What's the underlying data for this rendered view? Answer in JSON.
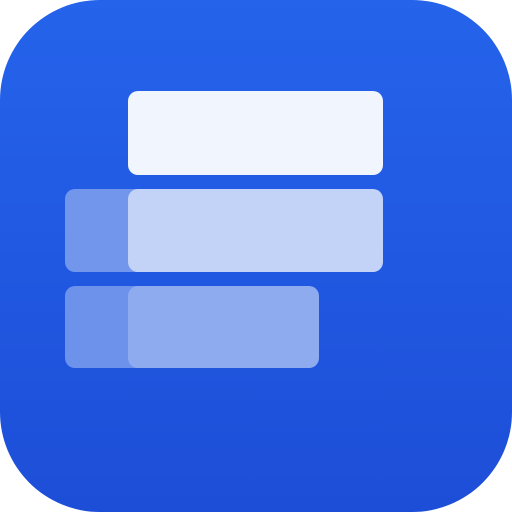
{
  "app_icon": {
    "name": "stacked-bars-app-icon",
    "icon": "stacked-layers-icon",
    "colors": {
      "background_top": "#2563EB",
      "background_bottom": "#1D4ED8",
      "bar_top": "#F1F5FD",
      "bar_middle_light": "#C3D3F7",
      "bar_middle_shadow": "#7196EC",
      "bar_bottom_light": "#8EABEF",
      "bar_bottom_shadow": "#6D92EC"
    }
  }
}
